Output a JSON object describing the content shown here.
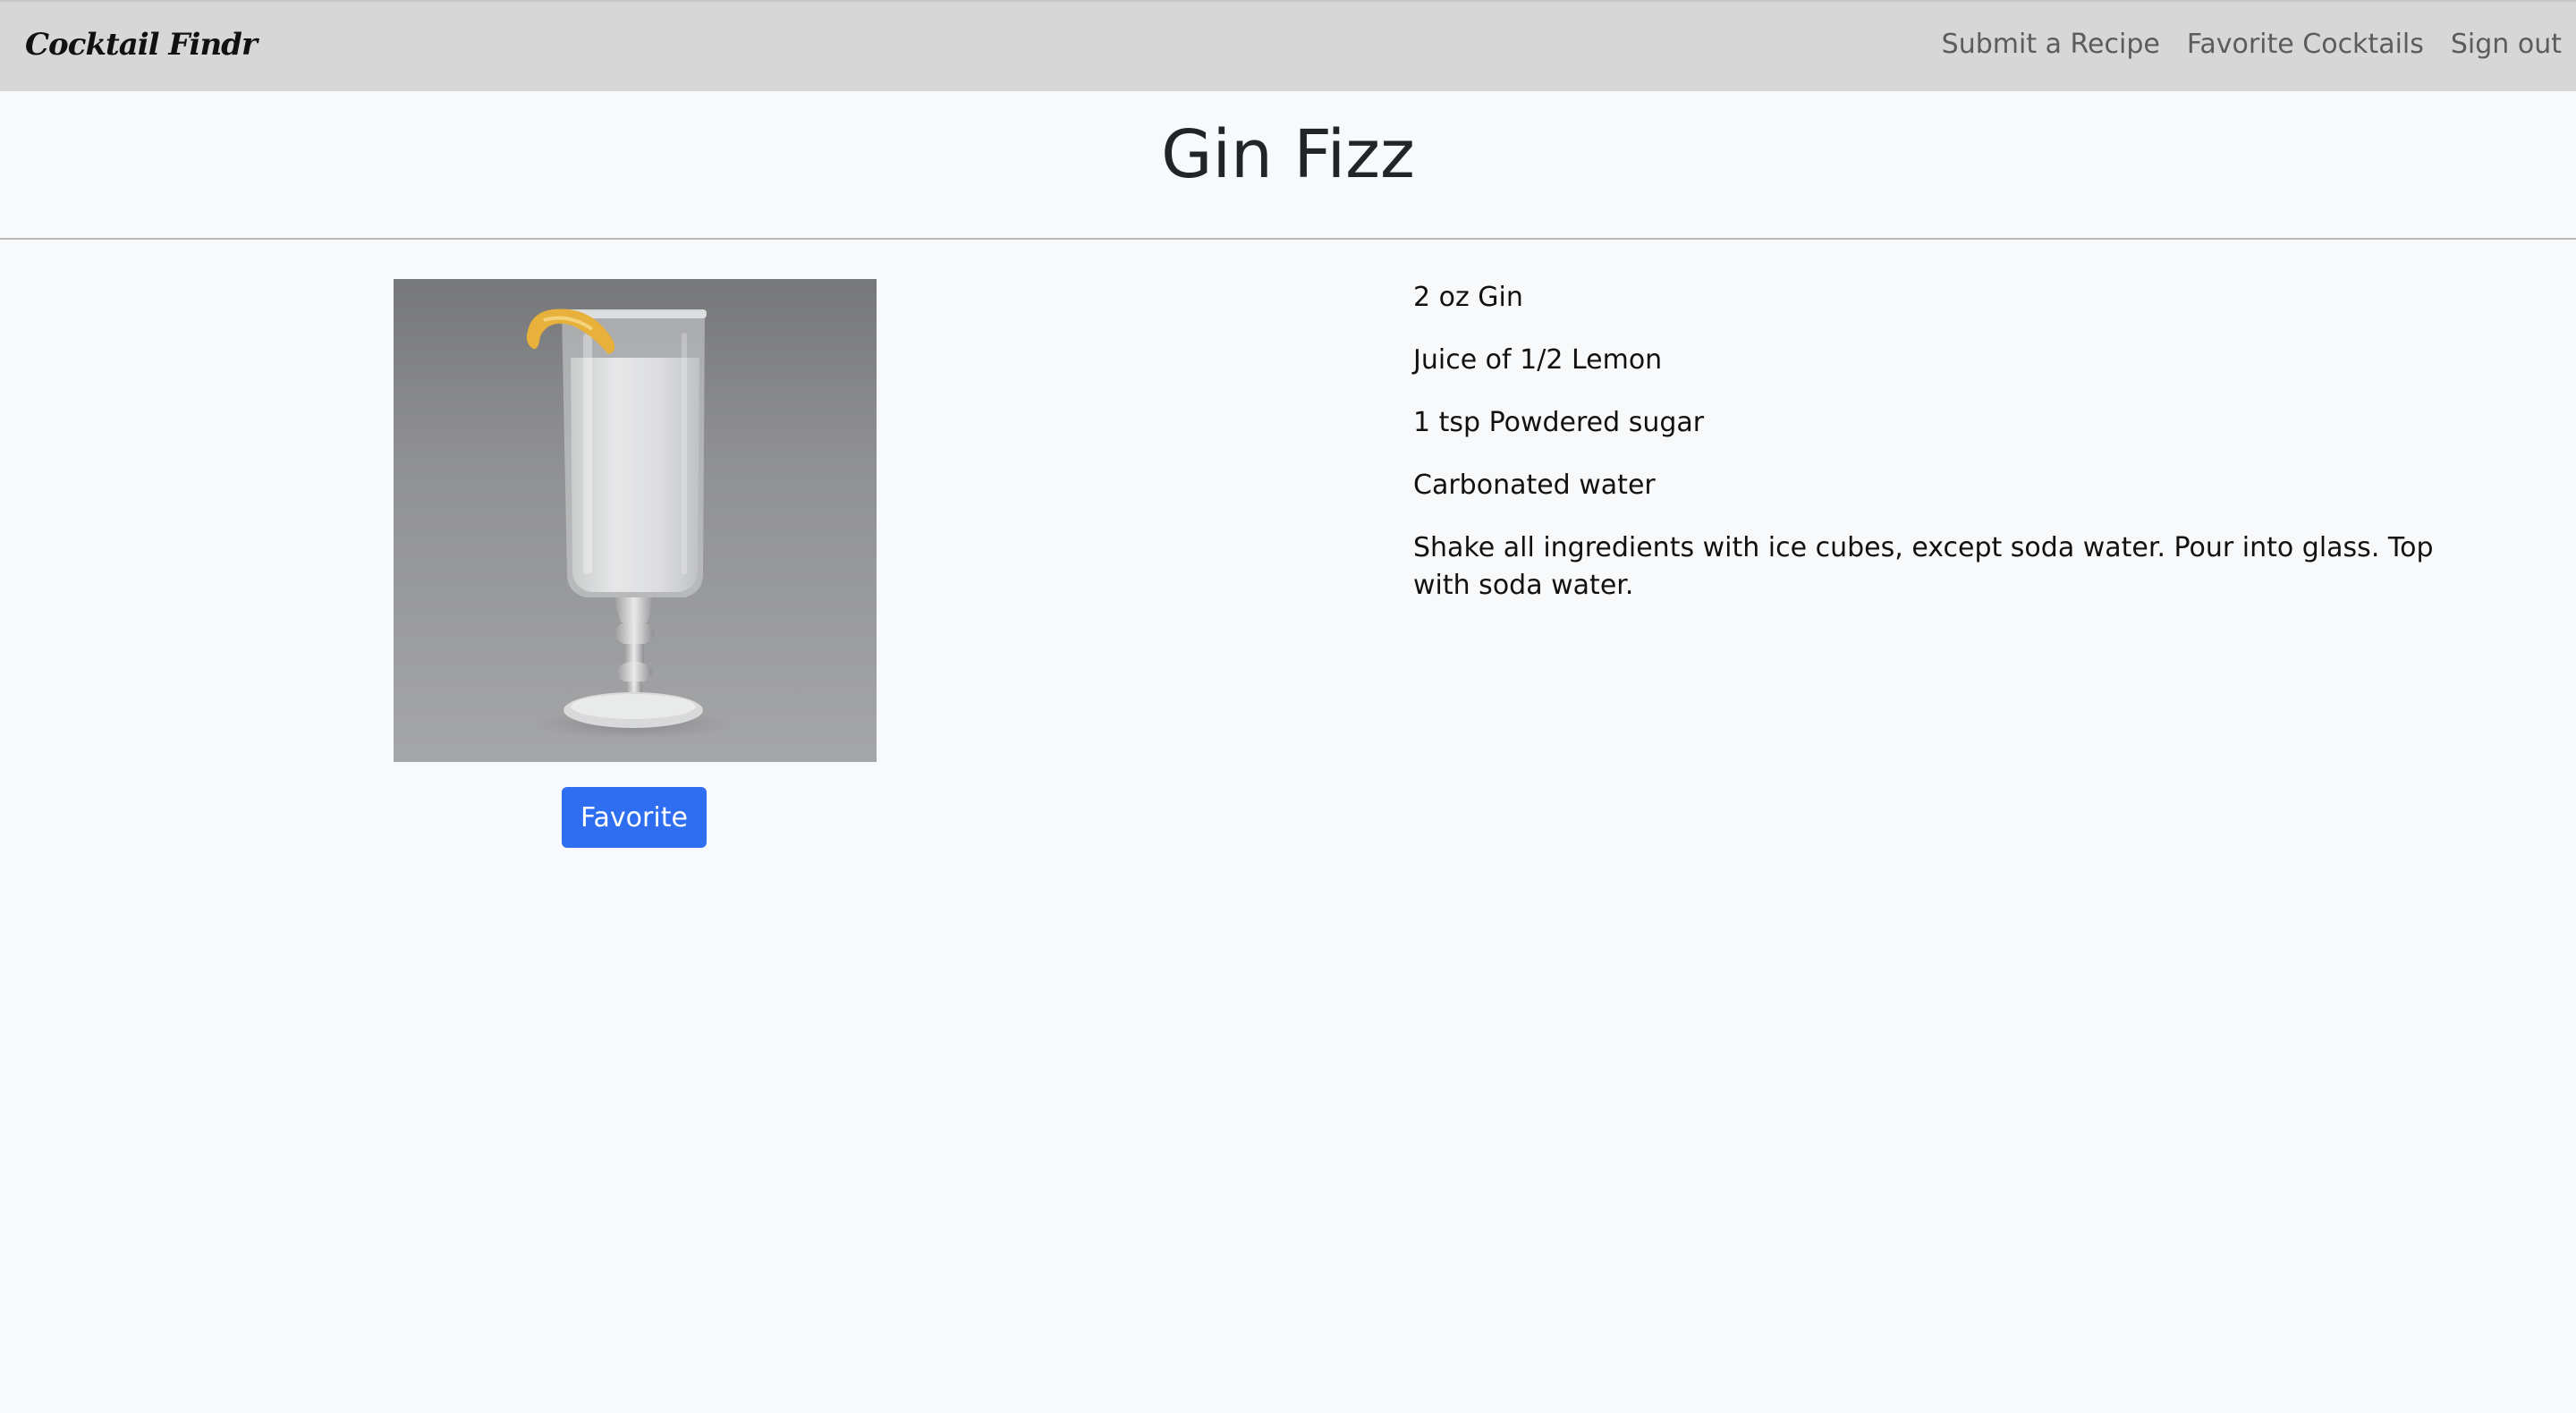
{
  "navbar": {
    "brand": "Cocktail Findr",
    "links": [
      {
        "label": "Submit a Recipe"
      },
      {
        "label": "Favorite Cocktails"
      },
      {
        "label": "Sign out"
      }
    ]
  },
  "cocktail": {
    "name": "Gin Fizz",
    "image_subject": "gin-fizz-glass-with-lemon-twist",
    "favorite_label": "Favorite",
    "ingredients": [
      "2 oz Gin",
      "Juice of 1/2 Lemon",
      "1 tsp Powdered sugar",
      "Carbonated water"
    ],
    "instructions": "Shake all ingredients with ice cubes, except soda water. Pour into glass. Top with soda water."
  },
  "colors": {
    "navbar_bg": "#d7d7d7",
    "page_bg": "#f8f9fa",
    "button_primary": "#2f6ef0"
  }
}
